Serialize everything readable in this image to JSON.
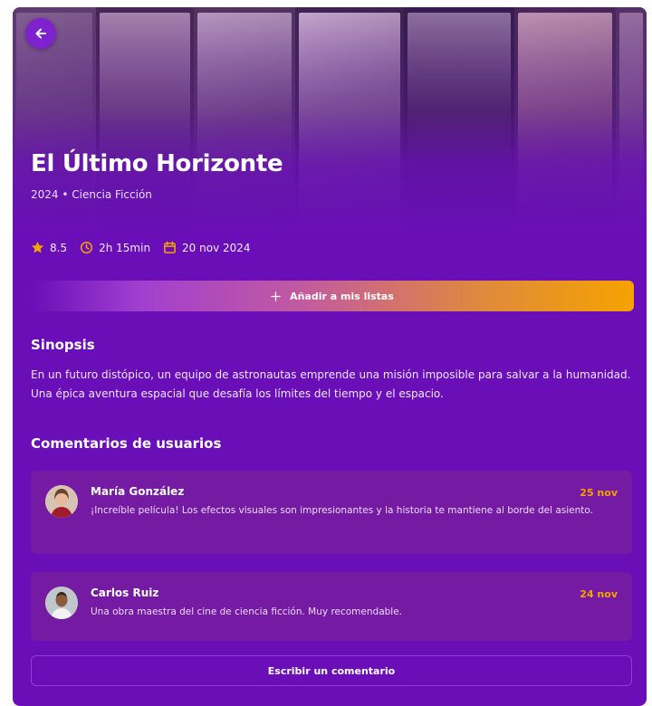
{
  "movie": {
    "title": "El Último Horizonte",
    "subtitle": "2024 • Ciencia Ficción",
    "rating": "8.5",
    "duration": "2h 15min",
    "release_date": "20 nov 2024"
  },
  "actions": {
    "add_to_lists_label": "Añadir a mis listas",
    "write_comment_label": "Escribir un comentario"
  },
  "synopsis": {
    "heading": "Sinopsis",
    "text": "En un futuro distópico, un equipo de astronautas emprende una misión imposible para salvar a la humanidad. Una épica aventura espacial que desafía los límites del tiempo y el espacio."
  },
  "comments": {
    "heading": "Comentarios de usuarios",
    "items": [
      {
        "author": "María González",
        "date": "25 nov",
        "text": "¡Increíble película! Los efectos visuales son impresionantes y la historia te mantiene al borde del asiento."
      },
      {
        "author": "Carlos Ruiz",
        "date": "24 nov",
        "text": "Una obra maestra del cine de ciencia ficción. Muy recomendable."
      }
    ]
  },
  "colors": {
    "background": "#6a0fb8",
    "accent": "#f5a300",
    "comment_card": "#751aa3"
  },
  "icons": [
    "back-arrow-icon",
    "star-icon",
    "clock-icon",
    "calendar-icon",
    "plus-icon"
  ]
}
